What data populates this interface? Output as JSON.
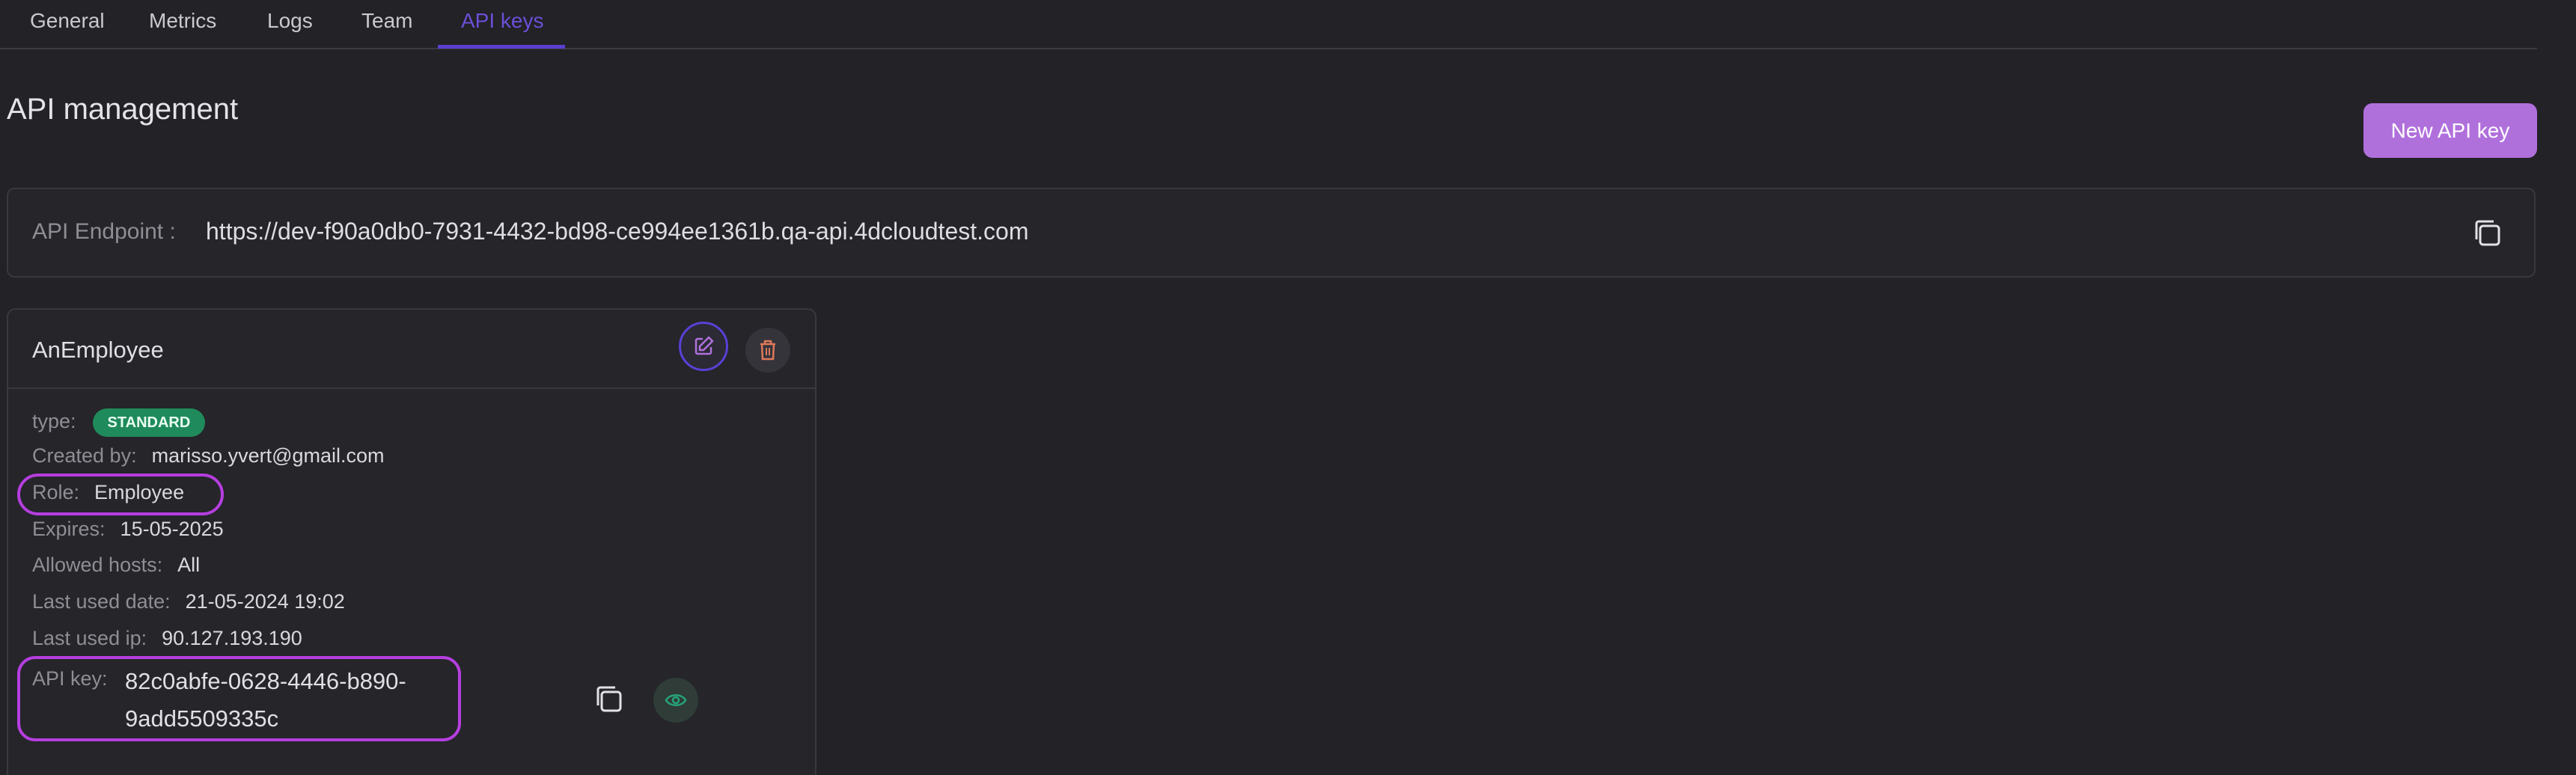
{
  "tabs": [
    {
      "label": "General",
      "active": false
    },
    {
      "label": "Metrics",
      "active": false
    },
    {
      "label": "Logs",
      "active": false
    },
    {
      "label": "Team",
      "active": false
    },
    {
      "label": "API keys",
      "active": true
    }
  ],
  "page": {
    "title": "API management",
    "new_key_button": "New API key"
  },
  "endpoint": {
    "label": "API Endpoint :",
    "value": "https://dev-f90a0db0-7931-4432-bd98-ce994ee1361b.qa-api.4dcloudtest.com",
    "copy_icon": "copy-icon"
  },
  "key_card": {
    "name": "AnEmployee",
    "edit_icon": "edit-icon",
    "delete_icon": "trash-icon",
    "type_label": "type:",
    "type_badge": "STANDARD",
    "created_by_label": "Created by:",
    "created_by_value": "marisso.yvert@gmail.com",
    "role_label": "Role:",
    "role_value": "Employee",
    "expires_label": "Expires:",
    "expires_value": "15-05-2025",
    "allowed_hosts_label": "Allowed hosts:",
    "allowed_hosts_value": "All",
    "last_used_date_label": "Last used date:",
    "last_used_date_value": "21-05-2024 19:02",
    "last_used_ip_label": "Last used ip:",
    "last_used_ip_value": "90.127.193.190",
    "api_key_label": "API key:",
    "api_key_value": "82c0abfe-0628-4446-b890-9add5509335c",
    "copy_icon": "copy-icon",
    "reveal_icon": "eye-icon"
  },
  "colors": {
    "accent": "#5b3fd0",
    "button": "#b070dc",
    "badge": "#1f8a5b",
    "highlight": "#b63ee0",
    "background": "#222227"
  }
}
